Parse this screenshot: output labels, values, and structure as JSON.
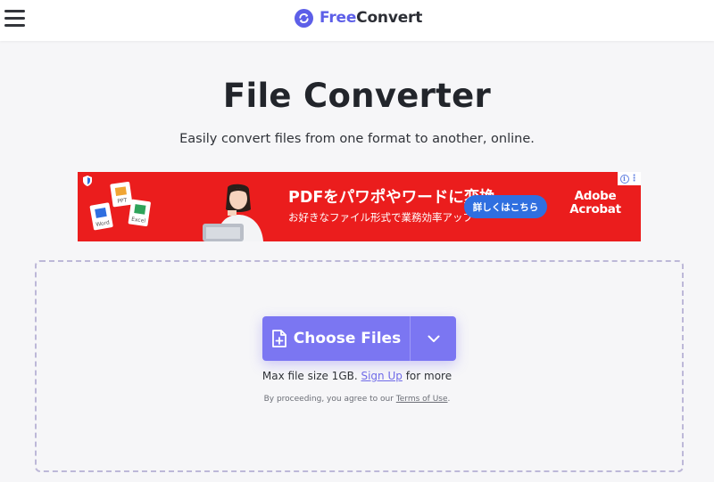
{
  "brand": {
    "name_part1": "Free",
    "name_part2": "Convert",
    "accent": "#5d5fe8",
    "icon": "refresh-icon"
  },
  "page": {
    "title": "File Converter",
    "subtitle": "Easily convert files from one format to another, online."
  },
  "ad": {
    "headline": "PDFをパワポやワードに変換",
    "subline": "お好きなファイル形式で業務効率アップ",
    "cta_label": "詳しくはこちら",
    "brand_line1": "Adobe",
    "brand_line2": "Acrobat",
    "doc_labels": [
      "PPT",
      "Word",
      "Excel"
    ],
    "background": "#eb1d1d",
    "cta_color": "#2f6fe0"
  },
  "upload": {
    "choose_label": "Choose Files",
    "button_color": "#7b76f2",
    "limit_prefix": "Max file size 1GB. ",
    "signup_label": "Sign Up",
    "limit_suffix": " for more",
    "legal_prefix": "By proceeding, you agree to our ",
    "terms_label": "Terms of Use",
    "legal_suffix": "."
  }
}
